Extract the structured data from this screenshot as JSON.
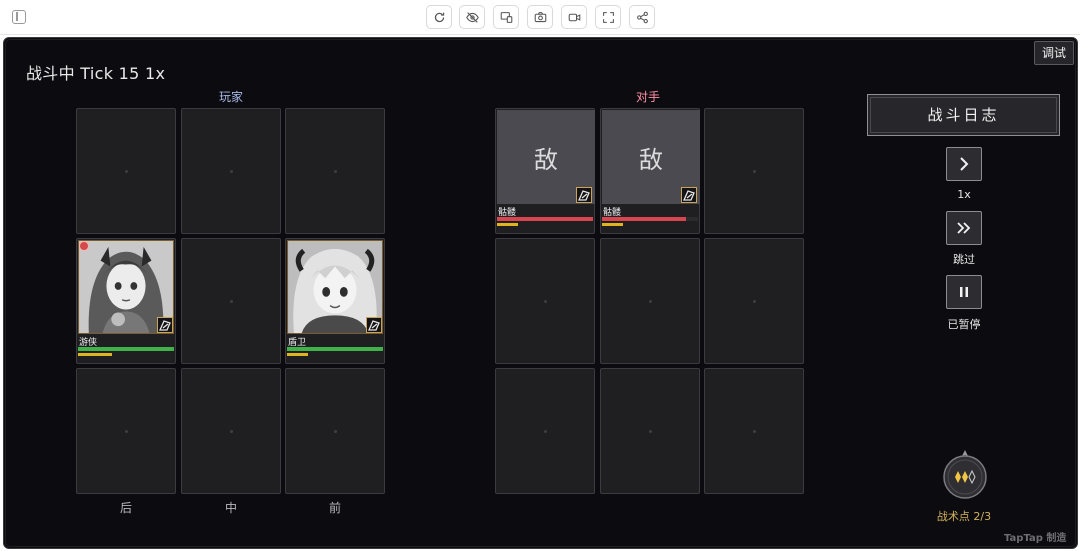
{
  "toolbar": {
    "buttons": [
      "refresh-icon",
      "eye-off-icon",
      "device-icon",
      "camera-icon",
      "video-icon",
      "fullscreen-icon",
      "share-icon"
    ]
  },
  "game": {
    "title": "战斗中 Tick 15 1x",
    "debug_label": "调试",
    "player_label": "玩家",
    "enemy_label": "对手",
    "columns": [
      "后",
      "中",
      "前"
    ],
    "player_units": [
      {
        "name": "游侠",
        "hp": 1.0,
        "energy": 0.35,
        "hp_color": "#3fb34a",
        "energy_color": "#e0b320"
      },
      {
        "name": "盾卫",
        "hp": 1.0,
        "energy": 0.22,
        "hp_color": "#3fb34a",
        "energy_color": "#e0b320"
      }
    ],
    "enemy_units": [
      {
        "glyph": "敌",
        "name": "骷髅",
        "hp": 1.0,
        "energy": 0.22,
        "hp_color": "#d9454f",
        "energy_color": "#e0b320"
      },
      {
        "glyph": "敌",
        "name": "骷髅",
        "hp": 0.88,
        "energy": 0.22,
        "hp_color": "#d9454f",
        "energy_color": "#e0b320"
      }
    ],
    "battle_log_label": "战斗日志",
    "controls": {
      "speed_label": "1x",
      "skip_label": "跳过",
      "pause_label": "已暂停"
    },
    "battle_points_label": "战术点 2/3",
    "watermark": "TapTap 制造"
  }
}
